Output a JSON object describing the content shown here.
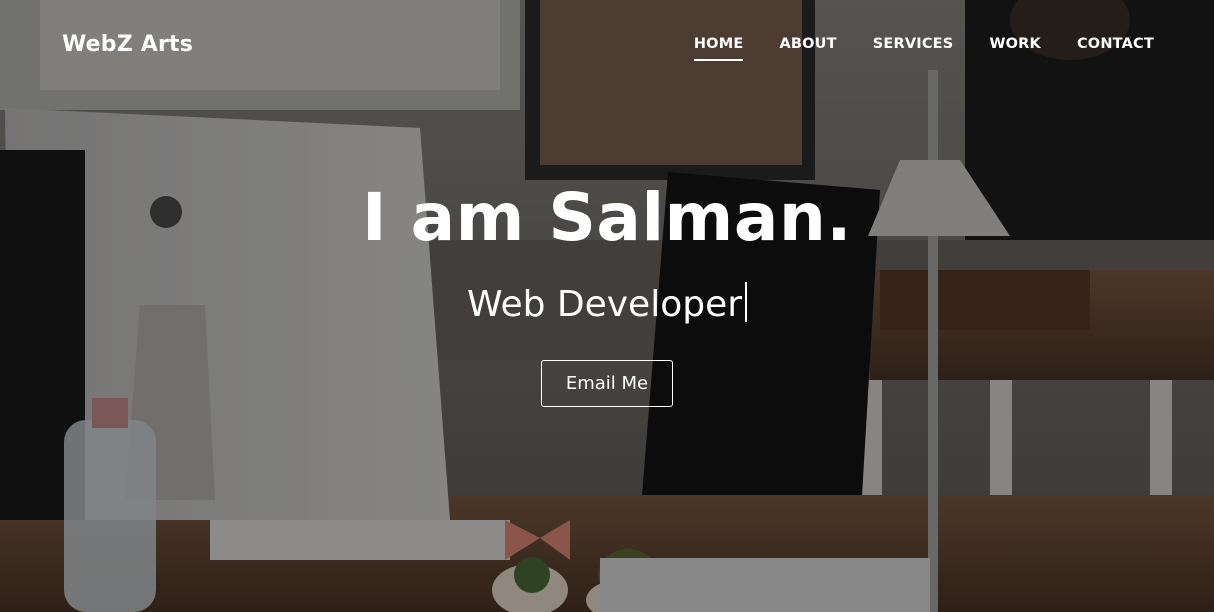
{
  "brand": {
    "label": "WebZ Arts"
  },
  "nav": {
    "items": [
      {
        "label": "HOME",
        "active": true
      },
      {
        "label": "ABOUT",
        "active": false
      },
      {
        "label": "SERVICES",
        "active": false
      },
      {
        "label": "WORK",
        "active": false
      },
      {
        "label": "CONTACT",
        "active": false
      }
    ]
  },
  "hero": {
    "title": "I am Salman.",
    "typed_text": "Web Developer",
    "cta_label": "Email Me"
  },
  "colors": {
    "text": "#ffffff",
    "overlay": "rgba(0,0,0,0.38)"
  }
}
